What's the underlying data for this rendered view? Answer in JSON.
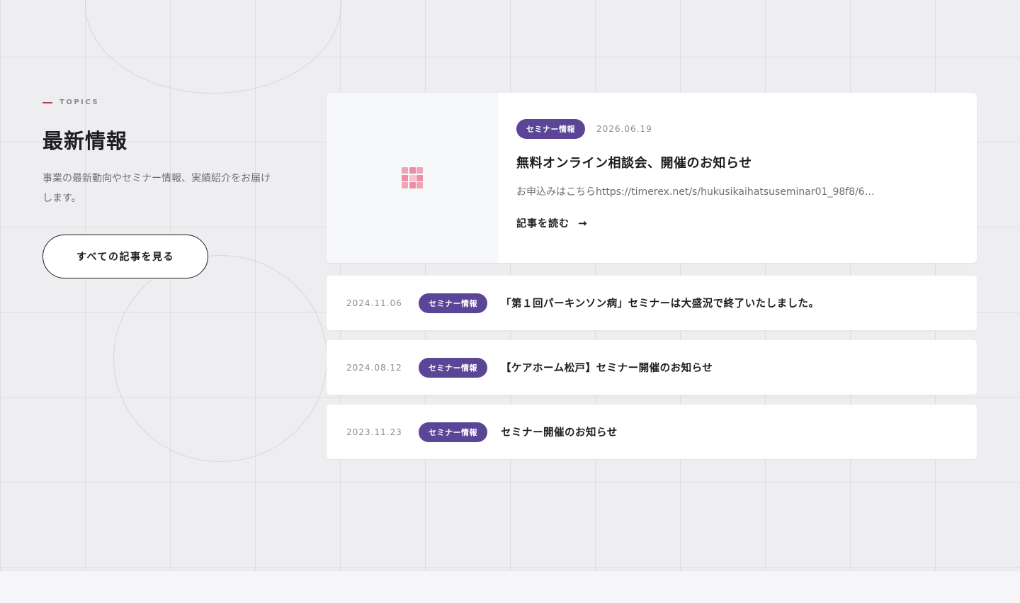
{
  "section": {
    "eyebrow": "TOPICS",
    "title": "最新情報",
    "description": "事業の最新動向やセミナー情報、実績紹介をお届けします。",
    "view_all_label": "すべての記事を見る"
  },
  "featured": {
    "category": "セミナー情報",
    "date": "2026.06.19",
    "title": "無料オンライン相談会、開催のお知らせ",
    "excerpt": "お申込みはこちらhttps://timerex.net/s/hukusikaihatsuseminar01_98f8/6…",
    "read_more_label": "記事を読む",
    "thumbnail_icon": "image-placeholder-icon"
  },
  "articles": [
    {
      "date": "2024.11.06",
      "category": "セミナー情報",
      "title": "「第１回パーキンソン病」セミナーは大盛況で終了いたしました。"
    },
    {
      "date": "2024.08.12",
      "category": "セミナー情報",
      "title": "【ケアホーム松戸】セミナー開催のお知らせ"
    },
    {
      "date": "2023.11.23",
      "category": "セミナー情報",
      "title": "セミナー開催のお知らせ"
    }
  ],
  "colors": {
    "accent": "#5a4597",
    "eyebrow_line": "#c23a4e",
    "background": "#eeeef0"
  }
}
